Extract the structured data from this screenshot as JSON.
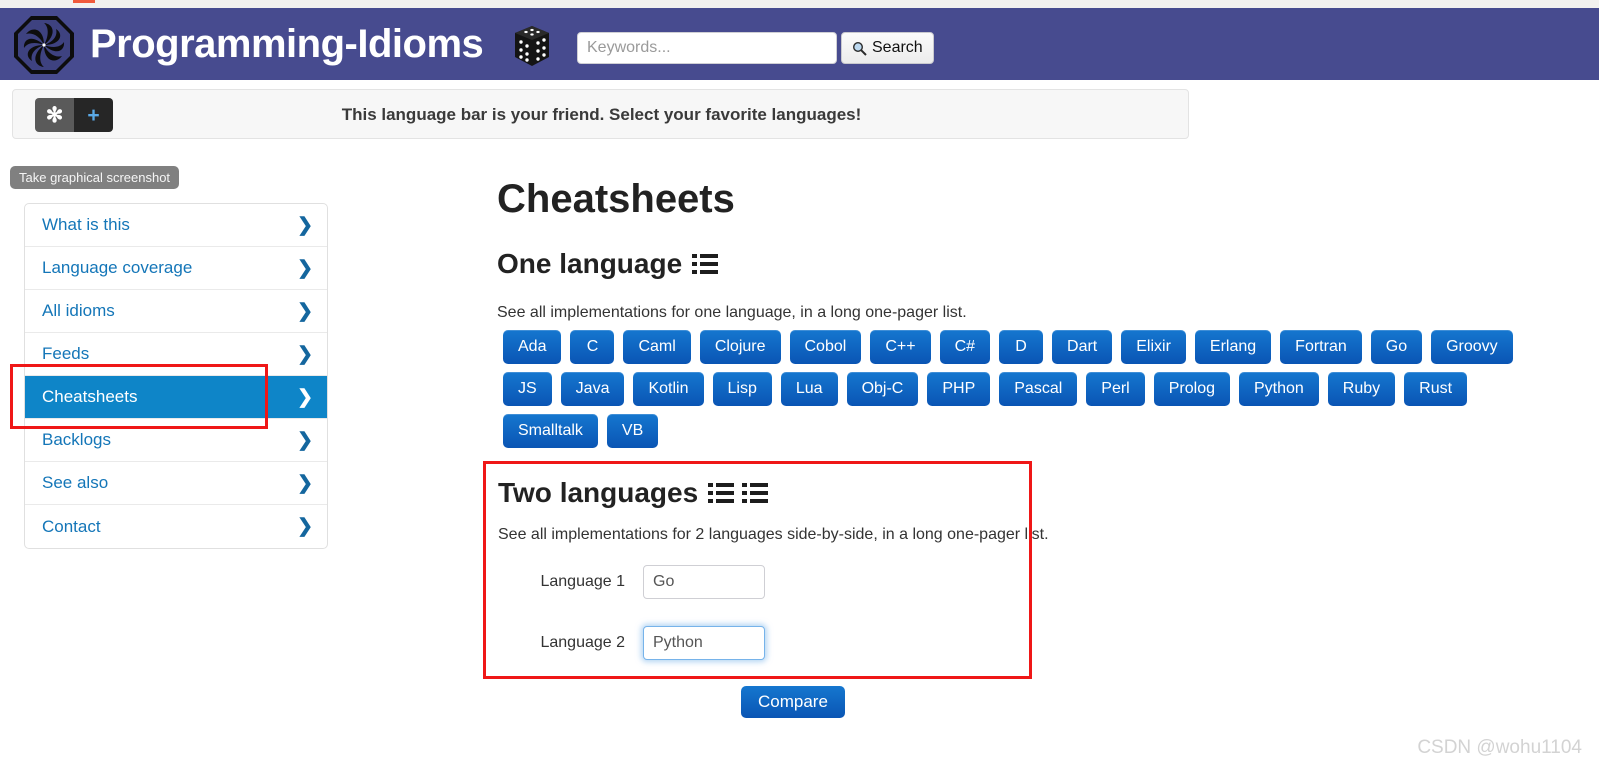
{
  "header": {
    "site_title": "Programming-Idioms",
    "logo_icon": "pinwheel-octagon-logo",
    "dice_icon": "dice-cube-icon",
    "search": {
      "placeholder": "Keywords...",
      "value": "",
      "button_label": "Search",
      "button_icon": "magnifier-icon"
    },
    "bg_color": "#474b8f"
  },
  "language_bar": {
    "message": "This language bar is your friend. Select your favorite languages!",
    "star_button_label": "✻",
    "plus_button_label": "+",
    "star_icon": "asterisk-icon",
    "plus_icon": "plus-icon"
  },
  "tooltip": {
    "text": "Take graphical screenshot"
  },
  "sidebar": {
    "items": [
      {
        "label": "What is this",
        "active": false
      },
      {
        "label": "Language coverage",
        "active": false
      },
      {
        "label": "All idioms",
        "active": false
      },
      {
        "label": "Feeds",
        "active": false
      },
      {
        "label": "Cheatsheets",
        "active": true
      },
      {
        "label": "Backlogs",
        "active": false
      },
      {
        "label": "See also",
        "active": false
      },
      {
        "label": "Contact",
        "active": false
      }
    ],
    "chevron_icon": "chevron-right-icon",
    "active_color": "#0e85c8",
    "link_color": "#1476b8"
  },
  "main": {
    "page_title": "Cheatsheets",
    "one_language": {
      "heading": "One language",
      "heading_icon": "list-icon",
      "description": "See all implementations for one language, in a long one-pager list.",
      "rows": [
        [
          "Ada",
          "C",
          "Caml",
          "Clojure",
          "Cobol",
          "C++",
          "C#",
          "D",
          "Dart",
          "Elixir",
          "Erlang",
          "Fortran",
          "Go",
          "Groovy"
        ],
        [
          "JS",
          "Java",
          "Kotlin",
          "Lisp",
          "Lua",
          "Obj-C",
          "PHP",
          "Pascal",
          "Perl",
          "Prolog",
          "Python",
          "Ruby",
          "Rust"
        ],
        [
          "Smalltalk",
          "VB"
        ]
      ]
    },
    "two_languages": {
      "heading": "Two languages",
      "heading_icon_1": "list-icon",
      "heading_icon_2": "list-icon",
      "description": "See all implementations for 2 languages side-by-side, in a long one-pager list.",
      "field1_label": "Language 1",
      "field1_value": "Go",
      "field2_label": "Language 2",
      "field2_value": "Python",
      "compare_label": "Compare"
    }
  },
  "watermark": {
    "text": "CSDN @wohu1104"
  },
  "annotations": {
    "sidebar_highlight": "red-rectangle-around-cheatsheets",
    "two_languages_highlight": "red-rectangle-around-two-languages"
  }
}
